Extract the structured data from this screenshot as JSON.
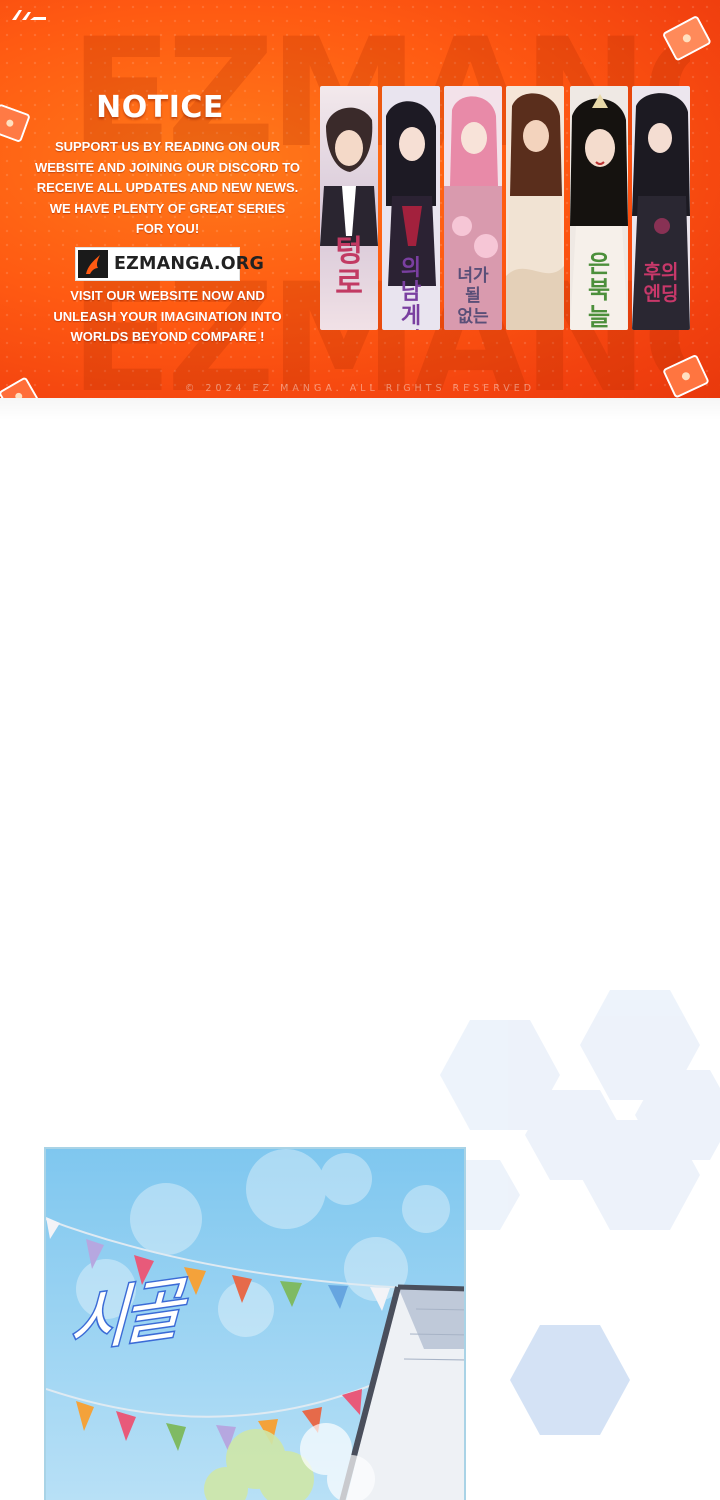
{
  "banner": {
    "logo_text": "EZ",
    "watermark_text": "EZMANGA",
    "notice_title": "NOTICE",
    "support_lines": [
      "SUPPORT US BY READING ON OUR",
      "WEBSITE AND JOINING OUR DISCORD TO",
      "RECEIVE ALL UPDATES AND NEW NEWS.",
      "WE HAVE PLENTY OF GREAT SERIES",
      "FOR YOU!"
    ],
    "site_badge": "EZMANGA.ORG",
    "visit_lines": [
      "VISIT OUR WEBSITE NOW AND",
      "UNLEASH YOUR IMAGINATION INTO",
      "WORLDS BEYOND COMPARE !"
    ],
    "copyright": "© 2024 EZ MANGA. ALL RIGHTS RESERVED",
    "covers": [
      {
        "title": "텅 로",
        "accent": "#c23a63"
      },
      {
        "title": "의 남 게 집",
        "accent": "#7a3fa0"
      },
      {
        "title": "녀가 될 없는",
        "accent": "#6b5b8a"
      },
      {
        "title": "",
        "accent": "#b88455"
      },
      {
        "title": "은 북 늘",
        "accent": "#4c8f3b"
      },
      {
        "title": "후의 엔딩",
        "accent": "#c8386a"
      }
    ],
    "colors": {
      "primary": "#ff5a12",
      "deep": "#e8380c"
    }
  },
  "panel": {
    "title": "시골",
    "colors": {
      "sky": "#8fcdf0",
      "outline": "#3b6bd6"
    }
  }
}
